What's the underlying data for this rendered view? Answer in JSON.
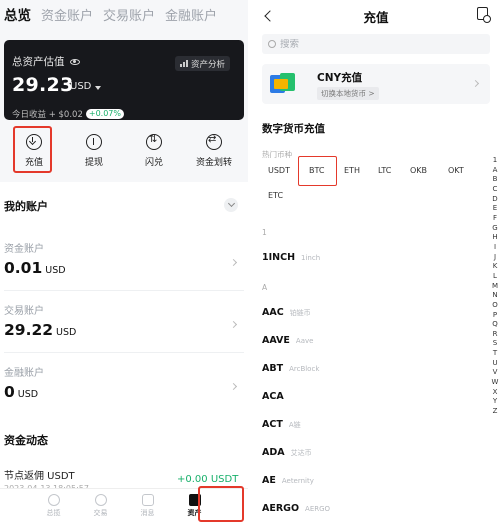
{
  "left": {
    "tabs": [
      {
        "label": "总览",
        "active": true
      },
      {
        "label": "资金账户"
      },
      {
        "label": "交易账户"
      },
      {
        "label": "金融账户"
      }
    ],
    "asset_card": {
      "label": "总资产估值",
      "amount": "29.23",
      "unit": "USD",
      "analysis_label": "资产分析",
      "earn_label": "今日收益 + $0.02",
      "earn_change": "+0.07%"
    },
    "actions": [
      {
        "label": "充值",
        "icon": "deposit-icon"
      },
      {
        "label": "提现",
        "icon": "withdraw-icon"
      },
      {
        "label": "闪兑",
        "icon": "swap-icon"
      },
      {
        "label": "资金划转",
        "icon": "transfer-icon"
      }
    ],
    "my_accounts": {
      "title": "我的账户",
      "items": [
        {
          "name": "资金账户",
          "value": "0.01",
          "unit": "USD"
        },
        {
          "name": "交易账户",
          "value": "29.22",
          "unit": "USD"
        },
        {
          "name": "金融账户",
          "value": "0",
          "unit": "USD"
        }
      ]
    },
    "fund_activity": {
      "title": "资金动态",
      "item_name": "节点返佣 USDT",
      "item_amount": "+0.00 USDT",
      "item_time": "2023-04-13 18:05:57"
    },
    "bottom_nav": [
      {
        "label": "总揽",
        "icon": "overview-icon"
      },
      {
        "label": "交易",
        "icon": "trade-icon"
      },
      {
        "label": "消息",
        "icon": "message-icon"
      },
      {
        "label": "资产",
        "icon": "wallet-icon",
        "active": true
      }
    ]
  },
  "right": {
    "title": "充值",
    "search_placeholder": "搜索",
    "cny": {
      "name": "CNY充值",
      "sub": "切换本地货币 >"
    },
    "section_title": "数字货币充值",
    "hot_label": "热门币种",
    "hot_coins": [
      "USDT",
      "BTC",
      "ETH",
      "LTC",
      "OKB",
      "OKT",
      "ETC"
    ],
    "groups": [
      {
        "letter": "1",
        "coins": [
          {
            "symbol": "1INCH",
            "full": "1inch"
          }
        ]
      },
      {
        "letter": "A",
        "coins": [
          {
            "symbol": "AAC",
            "full": "铂链币"
          },
          {
            "symbol": "AAVE",
            "full": "Aave"
          },
          {
            "symbol": "ABT",
            "full": "ArcBlock"
          },
          {
            "symbol": "ACA",
            "full": ""
          },
          {
            "symbol": "ACT",
            "full": "A链"
          },
          {
            "symbol": "ADA",
            "full": "艾达币"
          },
          {
            "symbol": "AE",
            "full": "Aeternity"
          },
          {
            "symbol": "AERGO",
            "full": "AERGO"
          }
        ]
      }
    ],
    "alphabet": [
      "1",
      "A",
      "B",
      "C",
      "D",
      "E",
      "F",
      "G",
      "H",
      "I",
      "J",
      "K",
      "L",
      "M",
      "N",
      "O",
      "P",
      "Q",
      "R",
      "S",
      "T",
      "U",
      "V",
      "W",
      "X",
      "Y",
      "Z"
    ]
  },
  "colors": {
    "highlight": "#e4392b",
    "positive": "#18b06b",
    "card_bg": "#17181c"
  }
}
